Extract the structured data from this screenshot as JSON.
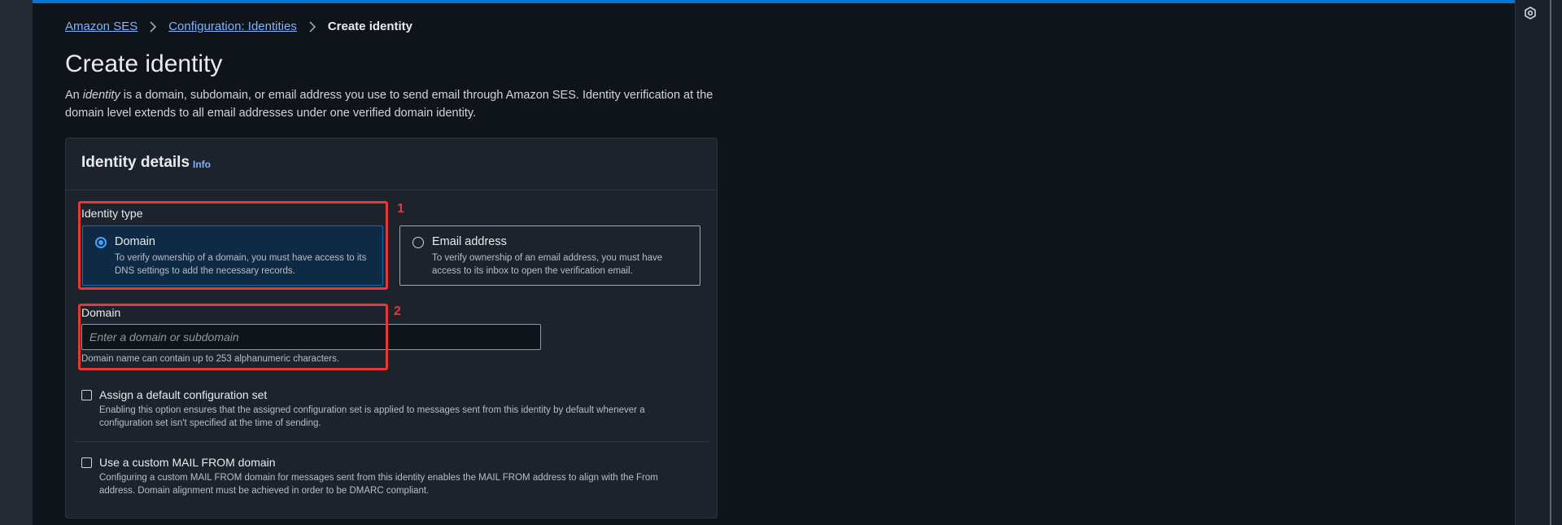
{
  "breadcrumb": {
    "items": [
      {
        "label": "Amazon SES"
      },
      {
        "label": "Configuration: Identities"
      },
      {
        "label": "Create identity"
      }
    ]
  },
  "page": {
    "title": "Create identity",
    "description_prefix": "An ",
    "description_emphasis": "identity",
    "description_suffix": " is a domain, subdomain, or email address you use to send email through Amazon SES. Identity verification at the domain level extends to all email addresses under one verified domain identity."
  },
  "panel": {
    "title": "Identity details",
    "info_link": "Info",
    "identity_type": {
      "label": "Identity type",
      "options": [
        {
          "title": "Domain",
          "description": "To verify ownership of a domain, you must have access to its DNS settings to add the necessary records.",
          "selected": true
        },
        {
          "title": "Email address",
          "description": "To verify ownership of an email address, you must have access to its inbox to open the verification email.",
          "selected": false
        }
      ]
    },
    "domain": {
      "label": "Domain",
      "value": "",
      "placeholder": "Enter a domain or subdomain",
      "hint": "Domain name can contain up to 253 alphanumeric characters."
    },
    "options": [
      {
        "title": "Assign a default configuration set",
        "description": "Enabling this option ensures that the assigned configuration set is applied to messages sent from this identity by default whenever a configuration set isn't specified at the time of sending.",
        "checked": false
      },
      {
        "title": "Use a custom MAIL FROM domain",
        "description": "Configuring a custom MAIL FROM domain for messages sent from this identity enables the MAIL FROM address to align with the From address. Domain alignment must be achieved in order to be DMARC compliant.",
        "checked": false
      }
    ]
  },
  "annotations": [
    "1",
    "2"
  ],
  "colors": {
    "accent": "#0972d3",
    "link": "#7fb2ff",
    "selected_tile_bg": "#0e2a44",
    "annotation": "#e53935"
  }
}
